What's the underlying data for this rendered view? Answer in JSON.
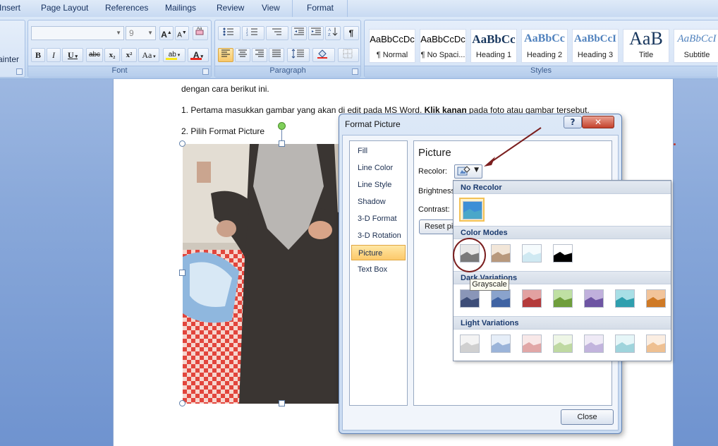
{
  "ribbon": {
    "tabs": [
      {
        "label": "Insert"
      },
      {
        "label": "Page Layout"
      },
      {
        "label": "References"
      },
      {
        "label": "Mailings"
      },
      {
        "label": "Review"
      },
      {
        "label": "View"
      },
      {
        "label": "Format"
      }
    ],
    "clipboard": {
      "painter_label": "ainter"
    },
    "font": {
      "group_label": "Font",
      "font_name": "",
      "font_size": "9",
      "grow_label": "A",
      "shrink_label": "A",
      "bold": "B",
      "italic": "I",
      "underline": "U",
      "strike": "abc",
      "subscript": "x₂",
      "superscript": "x²",
      "change_case": "Aa",
      "highlight_label": "ab",
      "font_color_label": "A"
    },
    "paragraph": {
      "group_label": "Paragraph",
      "pilcrow": "¶"
    },
    "styles": {
      "group_label": "Styles",
      "items": [
        {
          "sample": "AaBbCcDc",
          "name": "¶ Normal"
        },
        {
          "sample": "AaBbCcDc",
          "name": "¶ No Spaci..."
        },
        {
          "sample": "AaBbCc",
          "name": "Heading 1"
        },
        {
          "sample": "AaBbCc",
          "name": "Heading 2"
        },
        {
          "sample": "AaBbCcI",
          "name": "Heading 3"
        },
        {
          "sample": "AaB",
          "name": "Title"
        },
        {
          "sample": "AaBbCcI",
          "name": "Subtitle"
        }
      ]
    }
  },
  "document": {
    "line1": "dengan cara berikut ini.",
    "line2_pre": "1. Pertama masukkan gambar yang akan di edit pada MS Word. ",
    "line2_bold": "Klik kanan",
    "line2_post": " pada foto atau gambar tersebut.",
    "line3": "2. Pilih Format Picture"
  },
  "dialog": {
    "title": "Format Picture",
    "help": "?",
    "close_x": "✕",
    "nav": [
      {
        "label": "Fill"
      },
      {
        "label": "Line Color"
      },
      {
        "label": "Line Style"
      },
      {
        "label": "Shadow"
      },
      {
        "label": "3-D Format"
      },
      {
        "label": "3-D Rotation"
      },
      {
        "label": "Picture"
      },
      {
        "label": "Text Box"
      }
    ],
    "selected_nav": "Picture",
    "panel": {
      "title": "Picture",
      "recolor_label": "Recolor:",
      "brightness_label": "Brightness",
      "contrast_label": "Contrast:",
      "reset_label": "Reset picture"
    },
    "close_button": "Close"
  },
  "recolor_menu": {
    "sections": [
      {
        "title": "No Recolor"
      },
      {
        "title": "Color Modes"
      },
      {
        "title": "Dark Variations"
      },
      {
        "title": "Light Variations"
      }
    ],
    "tooltip": "Grayscale",
    "no_recolor_swatch": {
      "sky": "#3d8fd6",
      "land": "#4aa7c9"
    },
    "color_modes": [
      {
        "name": "Grayscale",
        "sky": "#e8e8e8",
        "land": "#7a7a7a"
      },
      {
        "name": "Sepia",
        "sky": "#f2e6d8",
        "land": "#b8997d"
      },
      {
        "name": "Washout",
        "sky": "#f5fbfd",
        "land": "#cfe9f2"
      },
      {
        "name": "Black and White",
        "sky": "#ffffff",
        "land": "#000000"
      }
    ],
    "dark_variations": [
      {
        "sky": "#8a96b8",
        "land": "#3d4d78"
      },
      {
        "sky": "#8aa3cc",
        "land": "#3f63a3"
      },
      {
        "sky": "#e2a1a1",
        "land": "#b43b3b"
      },
      {
        "sky": "#bfe0a3",
        "land": "#6f9e3c"
      },
      {
        "sky": "#c0b0dc",
        "land": "#6e55a3"
      },
      {
        "sky": "#a8dfe6",
        "land": "#2f9fae"
      },
      {
        "sky": "#f2c49a",
        "land": "#cf7a26"
      }
    ],
    "light_variations": [
      {
        "sky": "#f4f4f4",
        "land": "#d0d0d0"
      },
      {
        "sky": "#e6eef8",
        "land": "#9bb4d9"
      },
      {
        "sky": "#f8e8e8",
        "land": "#e1a7a7"
      },
      {
        "sky": "#eef6e6",
        "land": "#bfd9a2"
      },
      {
        "sky": "#efeaf6",
        "land": "#c2b4dd"
      },
      {
        "sky": "#e6f6f8",
        "land": "#9fd4dc"
      },
      {
        "sky": "#fbeee2",
        "land": "#eec092"
      }
    ]
  },
  "colors": {
    "annotation": "#7b1f1f",
    "highlight_bar": "#f8e61b",
    "font_color_bar": "#e8281f",
    "shading_bar": "#e8281f"
  }
}
